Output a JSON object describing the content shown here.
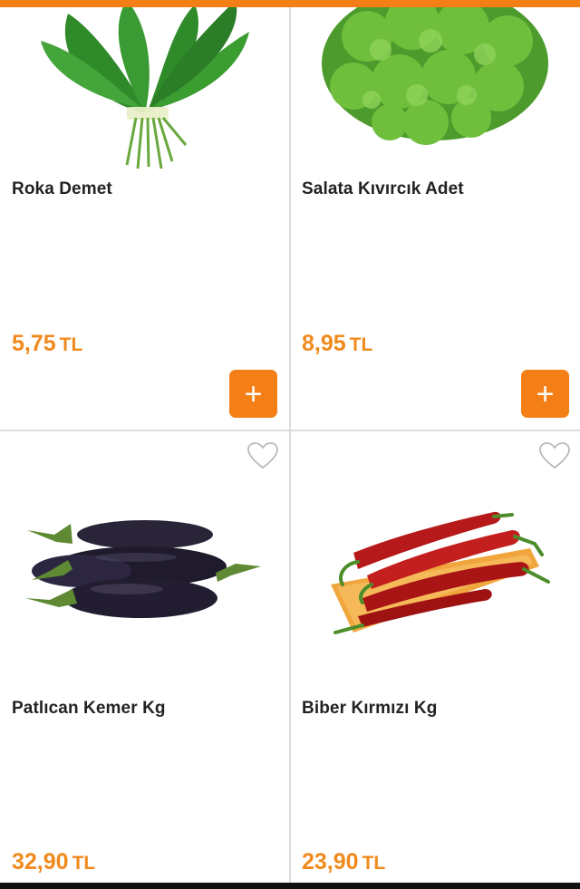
{
  "products": [
    {
      "name": "Roka Demet",
      "price": "5,75",
      "currency": "TL",
      "add_label": "+",
      "image": "arugula-bunch"
    },
    {
      "name": "Salata Kıvırcık Adet",
      "price": "8,95",
      "currency": "TL",
      "add_label": "+",
      "image": "curly-lettuce"
    },
    {
      "name": "Patlıcan Kemer Kg",
      "price": "32,90",
      "currency": "TL",
      "image": "eggplants"
    },
    {
      "name": "Biber Kırmızı Kg",
      "price": "23,90",
      "currency": "TL",
      "image": "red-peppers"
    }
  ],
  "colors": {
    "accent": "#f47f16",
    "price": "#f08a1c",
    "text": "#222222",
    "divider": "#dcdcdc"
  }
}
